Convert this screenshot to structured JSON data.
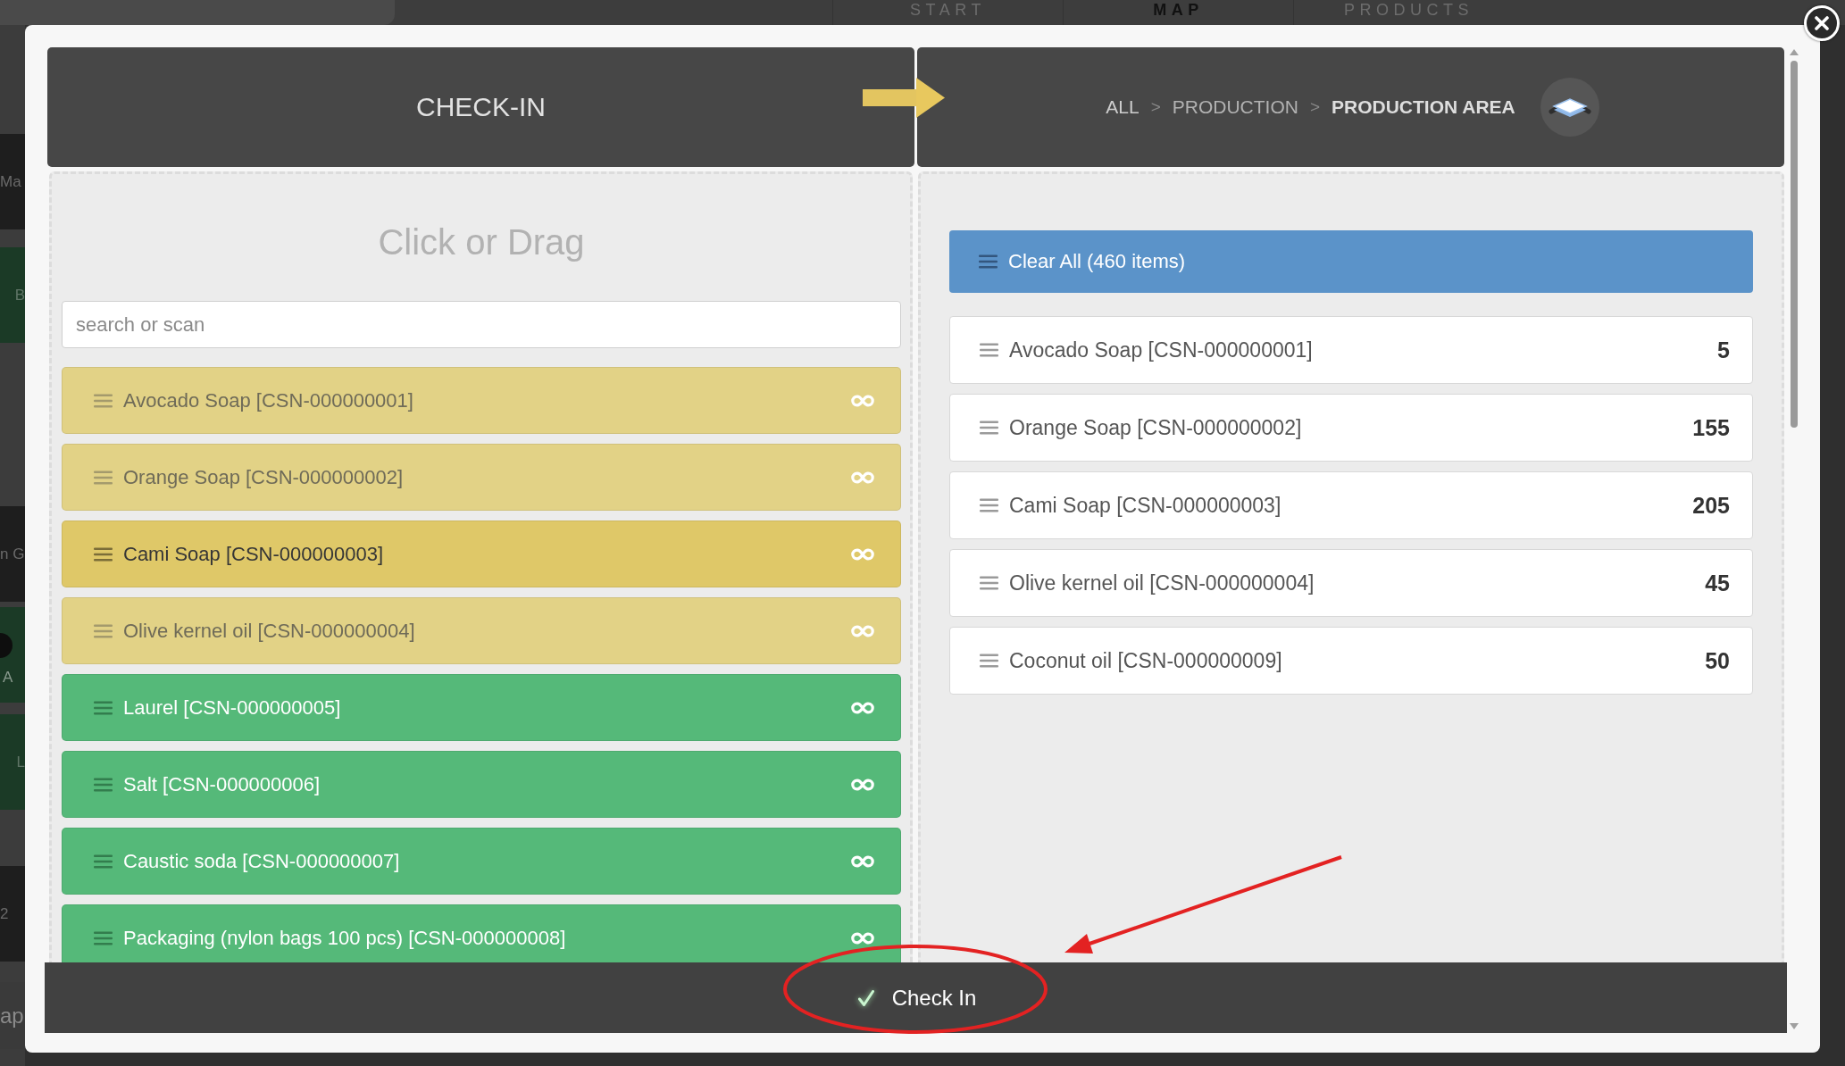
{
  "background": {
    "nav_tabs": [
      {
        "label": "START",
        "selected": false
      },
      {
        "label": "MAP",
        "selected": true
      },
      {
        "label": "PRODUCTS",
        "selected": false
      }
    ],
    "side_fragments": [
      {
        "kind": "dark",
        "text": "Ma"
      },
      {
        "kind": "green",
        "text": "B"
      },
      {
        "kind": "dark",
        "text": "n G"
      },
      {
        "kind": "avatar",
        "text": "A"
      },
      {
        "kind": "green",
        "text": "L"
      },
      {
        "kind": "dark",
        "text": "2"
      },
      {
        "kind": "plain",
        "text": "ap"
      }
    ]
  },
  "dialog": {
    "title": "CHECK-IN",
    "breadcrumb": [
      {
        "label": "ALL",
        "current": false,
        "separator": ">"
      },
      {
        "label": "PRODUCTION",
        "current": false,
        "separator": ">"
      },
      {
        "label": "PRODUCTION AREA",
        "current": true
      }
    ],
    "source_panel": {
      "heading": "Click or Drag",
      "search": {
        "placeholder": "search or scan"
      },
      "items": [
        {
          "label": "Avocado Soap [CSN-000000001]",
          "added": true,
          "highlighted": false
        },
        {
          "label": "Orange Soap [CSN-000000002]",
          "added": true,
          "highlighted": false
        },
        {
          "label": "Cami Soap [CSN-000000003]",
          "added": true,
          "highlighted": true
        },
        {
          "label": "Olive kernel oil [CSN-000000004]",
          "added": true,
          "highlighted": false
        },
        {
          "label": "Laurel [CSN-000000005]",
          "added": false,
          "highlighted": false
        },
        {
          "label": "Salt [CSN-000000006]",
          "added": false,
          "highlighted": false
        },
        {
          "label": "Caustic soda [CSN-000000007]",
          "added": false,
          "highlighted": false
        },
        {
          "label": "Packaging (nylon bags 100 pcs) [CSN-000000008]",
          "added": false,
          "highlighted": false
        }
      ]
    },
    "target_panel": {
      "clear_button": "Clear All (460 items)",
      "items": [
        {
          "label": "Avocado Soap [CSN-000000001]",
          "quantity": "5"
        },
        {
          "label": "Orange Soap [CSN-000000002]",
          "quantity": "155"
        },
        {
          "label": "Cami Soap [CSN-000000003]",
          "quantity": "205"
        },
        {
          "label": "Olive kernel oil [CSN-000000004]",
          "quantity": "45"
        },
        {
          "label": "Coconut oil [CSN-000000009]",
          "quantity": "50"
        }
      ]
    },
    "footer": {
      "button": "Check In"
    }
  }
}
